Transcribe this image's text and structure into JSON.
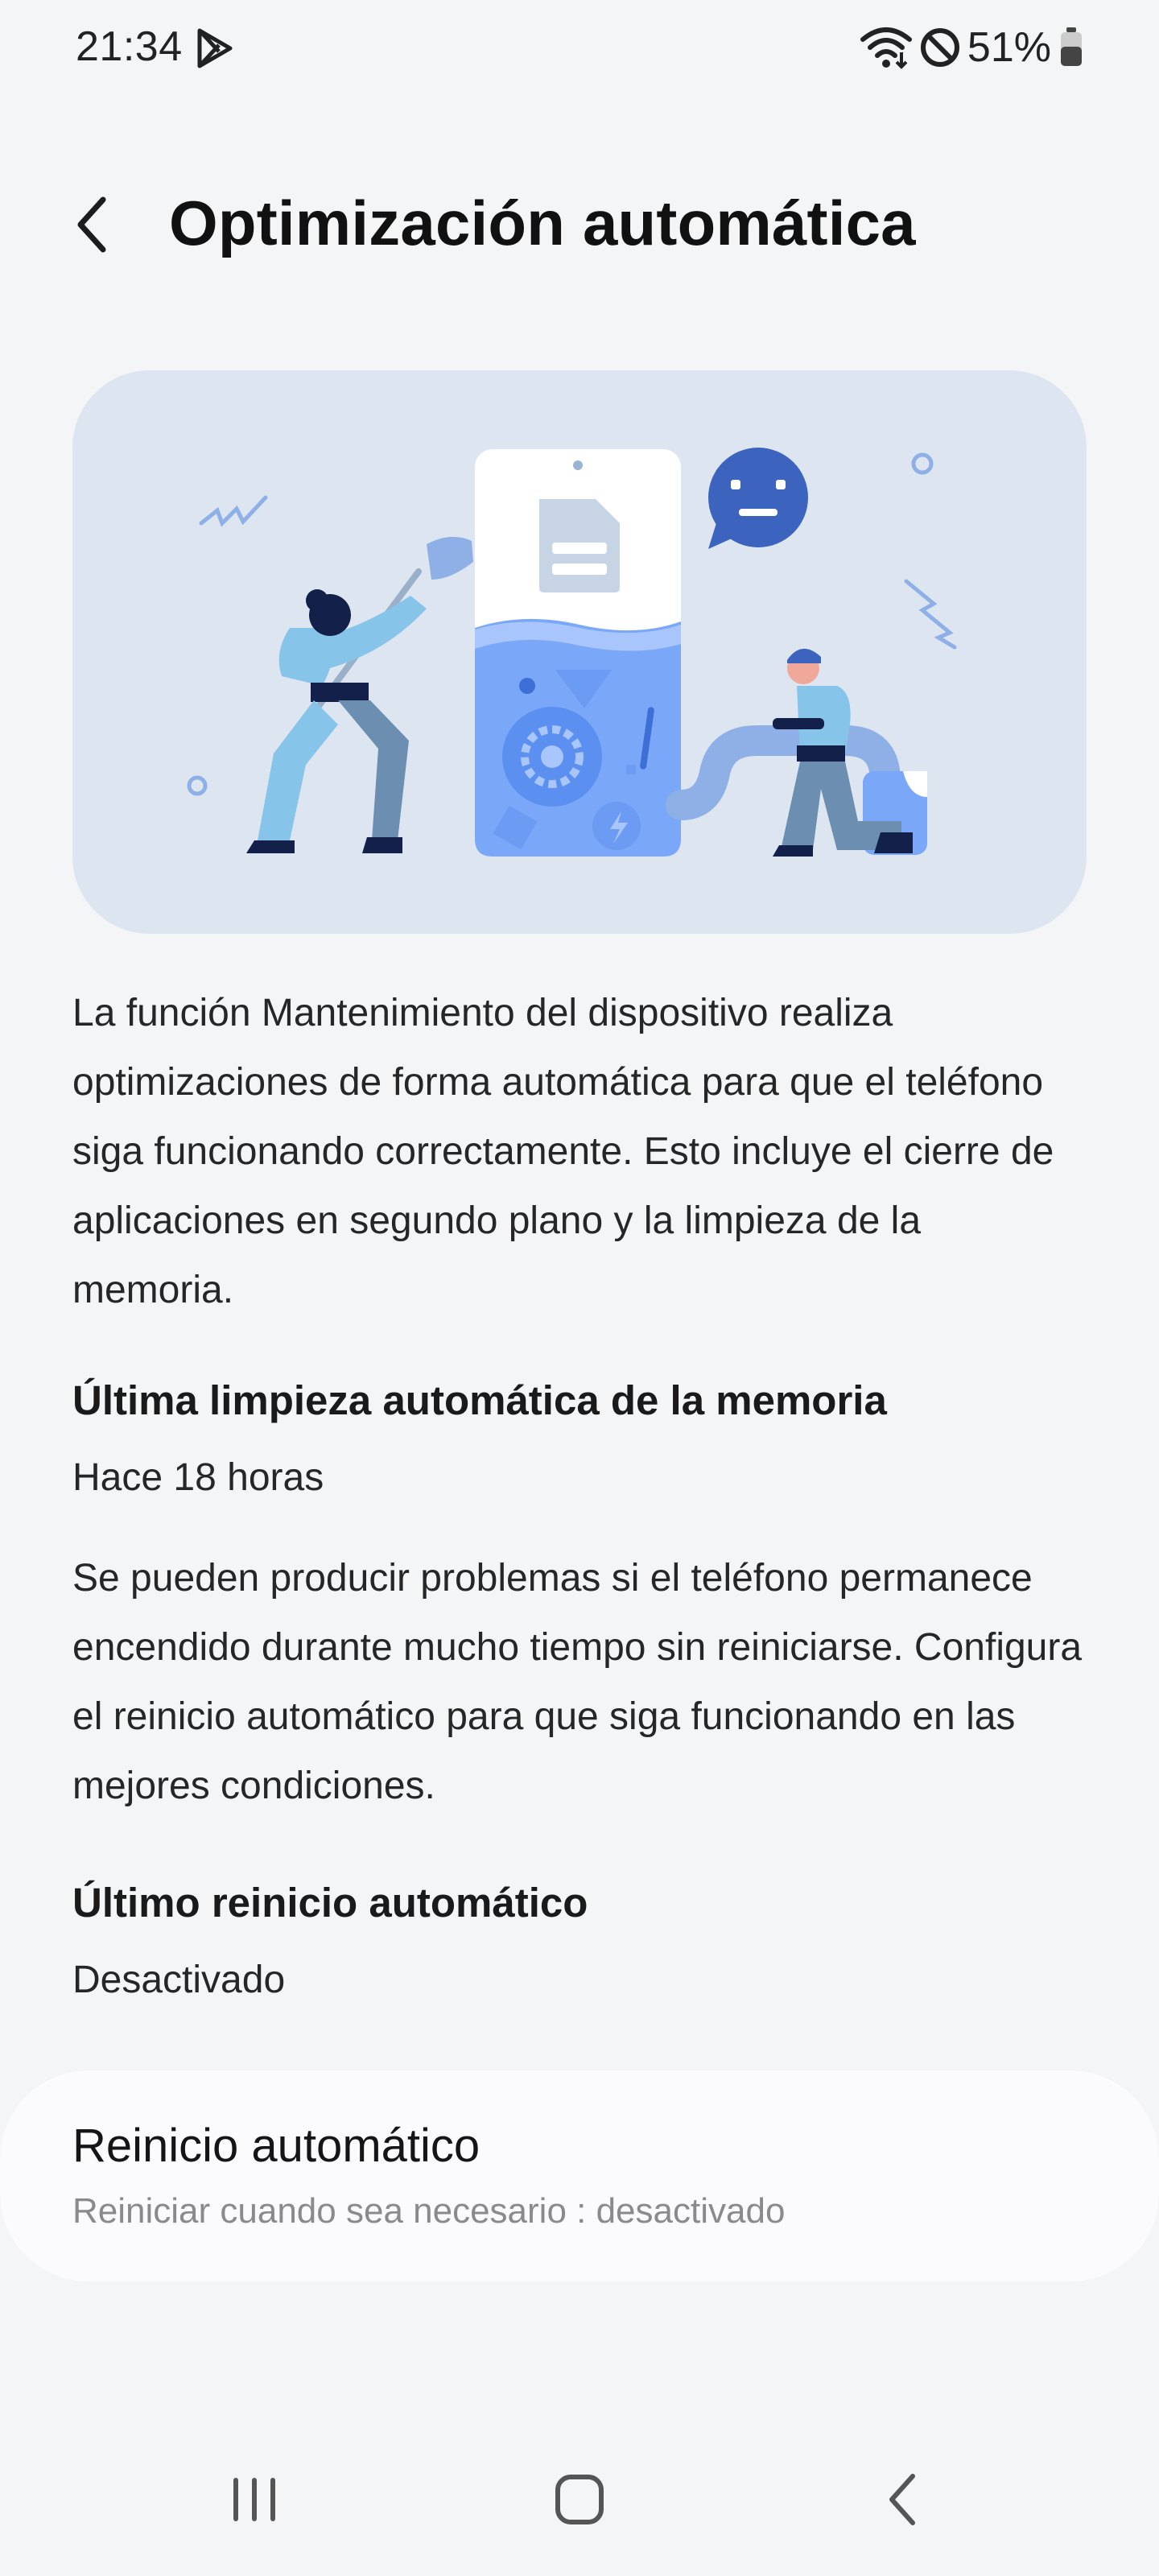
{
  "status_bar": {
    "time": "21:34",
    "battery": "51%",
    "icons": [
      "play-store-icon",
      "wifi-icon",
      "do-not-disturb-icon",
      "battery-icon"
    ]
  },
  "header": {
    "title": "Optimización automática",
    "back_icon": "chevron-left-icon"
  },
  "description": "La función Mantenimiento del dispositivo realiza optimizaciones de forma automática para que el teléfono siga funcionando correctamente. Esto incluye el cierre de aplicaciones en segundo plano y la limpieza de la memoria.",
  "memory": {
    "title": "Última limpieza automática de la memoria",
    "value": "Hace 18 horas"
  },
  "restart_info": "Se pueden producir problemas si el teléfono permanece encendido durante mucho tiempo sin reiniciarse. Configura el reinicio automático para que siga funcionando en las mejores condiciones.",
  "last_restart": {
    "title": "Último reinicio automático",
    "value": "Desactivado"
  },
  "auto_restart": {
    "title": "Reinicio automático",
    "subtitle": "Reiniciar cuando sea necesario : desactivado"
  },
  "nav": {
    "items": [
      "recent-apps-icon",
      "home-icon",
      "back-icon"
    ]
  },
  "colors": {
    "background": "#f4f5f7",
    "illustration_bg": "#dde6f0",
    "accent_blue": "#5b8ff0",
    "card_bg": "#fbfbfd"
  }
}
